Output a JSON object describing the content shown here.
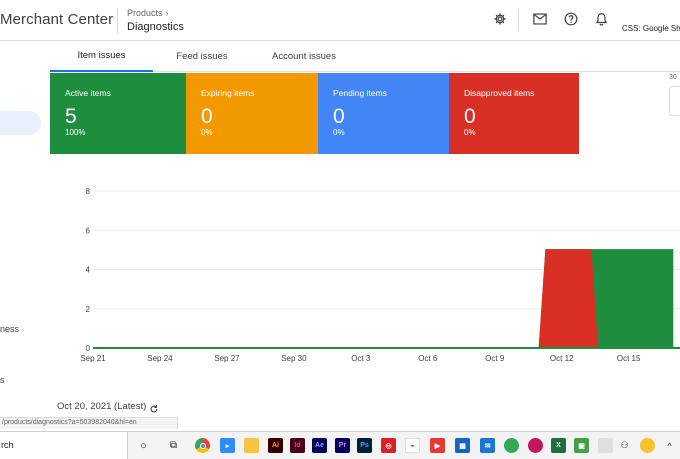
{
  "header": {
    "app_title": "Merchant Center",
    "breadcrumb": "Products",
    "page_title": "Diagnostics",
    "account": "CSS: Google Shop",
    "icons": [
      "settings-icon",
      "mail-icon",
      "help-icon",
      "notifications-icon"
    ]
  },
  "sidebar": {
    "fragments": [
      "ness",
      "s"
    ]
  },
  "tabs": [
    {
      "label": "Item issues",
      "active": true
    },
    {
      "label": "Feed issues",
      "active": false
    },
    {
      "label": "Account issues",
      "active": false
    }
  ],
  "cards": [
    {
      "label": "Active items",
      "value": "5",
      "percent": "100%",
      "color": "#1e8e3e"
    },
    {
      "label": "Expiring items",
      "value": "0",
      "percent": "0%",
      "color": "#f29900"
    },
    {
      "label": "Pending items",
      "value": "0",
      "percent": "0%",
      "color": "#4285f4"
    },
    {
      "label": "Disapproved items",
      "value": "0",
      "percent": "0%",
      "color": "#d93025"
    }
  ],
  "range_label": "30",
  "chart_data": {
    "type": "area",
    "x": [
      "Sep 21",
      "Sep 24",
      "Sep 27",
      "Sep 30",
      "Oct 3",
      "Oct 6",
      "Oct 9",
      "Oct 12",
      "Oct 15"
    ],
    "ylim": [
      0,
      8
    ],
    "yticks": [
      0,
      2,
      4,
      6,
      8
    ],
    "series": [
      {
        "color": "#d93025",
        "points": [
          [
            0,
            0
          ],
          [
            20,
            0
          ],
          [
            20.3,
            5
          ],
          [
            22.3,
            5
          ],
          [
            22.6,
            0
          ]
        ]
      },
      {
        "color": "#1e8e3e",
        "points": [
          [
            0,
            0
          ],
          [
            20,
            0
          ],
          [
            20.3,
            5
          ],
          [
            22.6,
            5
          ],
          [
            26,
            5
          ]
        ]
      }
    ]
  },
  "footer": {
    "date": "Oct 20, 2021 (Latest)",
    "url": "/products/diagnostics?a=503982040&hl=en"
  },
  "taskbar": {
    "search": "rch",
    "apps": [
      "cortana-icon",
      "task-view-icon",
      "chrome-icon",
      "zoom-icon",
      "files-icon",
      "illustrator-icon",
      "indesign-icon",
      "after-effects-icon",
      "premiere-icon",
      "photoshop-icon",
      "creative-cloud-icon",
      "acrobat-icon",
      "screen-recorder-icon",
      "calculator-icon",
      "mail-icon",
      "chrome-profile-icon",
      "chrome-profile-2-icon",
      "excel-icon",
      "app-icon",
      "tray-people-icon",
      "tray-icon",
      "tray-chevron-icon"
    ]
  }
}
